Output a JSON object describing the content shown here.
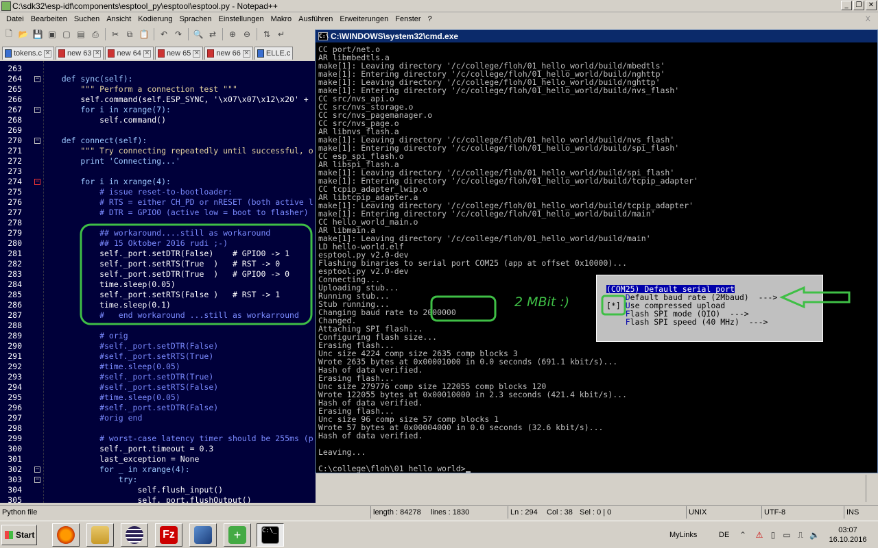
{
  "npp": {
    "title": "C:\\sdk32\\esp-idf\\components\\esptool_py\\esptool\\esptool.py - Notepad++",
    "menu": [
      "Datei",
      "Bearbeiten",
      "Suchen",
      "Ansicht",
      "Kodierung",
      "Sprachen",
      "Einstellungen",
      "Makro",
      "Ausführen",
      "Erweiterungen",
      "Fenster",
      "?"
    ],
    "menu_close": "X",
    "tabs": [
      "tokens.c",
      "new 63",
      "new 64",
      "new 65",
      "new 66",
      "ELLE.c"
    ],
    "status": {
      "type": "Python file",
      "length": "length : 84278",
      "lines": "lines : 1830",
      "ln": "Ln : 294",
      "col": "Col : 38",
      "sel": "Sel : 0 | 0",
      "eol": "UNIX",
      "enc": "UTF-8",
      "ins": "INS"
    }
  },
  "code_lines": [
    {
      "n": "263",
      "t": ""
    },
    {
      "n": "264",
      "t": "    def sync(self):"
    },
    {
      "n": "265",
      "t": "        \"\"\" Perform a connection test \"\"\""
    },
    {
      "n": "266",
      "t": "        self.command(self.ESP_SYNC, '\\x07\\x07\\x12\\x20' +"
    },
    {
      "n": "267",
      "t": "        for i in xrange(7):"
    },
    {
      "n": "268",
      "t": "            self.command()"
    },
    {
      "n": "269",
      "t": ""
    },
    {
      "n": "270",
      "t": "    def connect(self):"
    },
    {
      "n": "271",
      "t": "        \"\"\" Try connecting repeatedly until successful, o"
    },
    {
      "n": "272",
      "t": "        print 'Connecting...'"
    },
    {
      "n": "273",
      "t": ""
    },
    {
      "n": "274",
      "t": "        for i in xrange(4):"
    },
    {
      "n": "275",
      "t": "            # issue reset-to-bootloader:"
    },
    {
      "n": "276",
      "t": "            # RTS = either CH_PD or nRESET (both active l"
    },
    {
      "n": "277",
      "t": "            # DTR = GPIO0 (active low = boot to flasher)"
    },
    {
      "n": "278",
      "t": ""
    },
    {
      "n": "279",
      "t": "            ## workaround....still as workaround"
    },
    {
      "n": "280",
      "t": "            ## 15 Oktober 2016 rudi ;-)"
    },
    {
      "n": "281",
      "t": "            self._port.setDTR(False)    # GPIO0 -> 1"
    },
    {
      "n": "282",
      "t": "            self._port.setRTS(True  )   # RST -> 0"
    },
    {
      "n": "283",
      "t": "            self._port.setDTR(True  )   # GPIO0 -> 0"
    },
    {
      "n": "284",
      "t": "            time.sleep(0.05)"
    },
    {
      "n": "285",
      "t": "            self._port.setRTS(False )   # RST -> 1"
    },
    {
      "n": "286",
      "t": "            time.sleep(0.1)"
    },
    {
      "n": "287",
      "t": "            #   end workaround ...still as workarround"
    },
    {
      "n": "288",
      "t": ""
    },
    {
      "n": "289",
      "t": "            # orig"
    },
    {
      "n": "290",
      "t": "            #self._port.setDTR(False)"
    },
    {
      "n": "291",
      "t": "            #self._port.setRTS(True)"
    },
    {
      "n": "292",
      "t": "            #time.sleep(0.05)"
    },
    {
      "n": "293",
      "t": "            #self._port.setDTR(True)"
    },
    {
      "n": "294",
      "t": "            #self._port.setRTS(False)"
    },
    {
      "n": "295",
      "t": "            #time.sleep(0.05)"
    },
    {
      "n": "296",
      "t": "            #self._port.setDTR(False)"
    },
    {
      "n": "297",
      "t": "            #orig end"
    },
    {
      "n": "298",
      "t": ""
    },
    {
      "n": "299",
      "t": "            # worst-case latency timer should be 255ms (p"
    },
    {
      "n": "300",
      "t": "            self._port.timeout = 0.3"
    },
    {
      "n": "301",
      "t": "            last_exception = None"
    },
    {
      "n": "302",
      "t": "            for _ in xrange(4):"
    },
    {
      "n": "303",
      "t": "                try:"
    },
    {
      "n": "304",
      "t": "                    self.flush_input()"
    },
    {
      "n": "305",
      "t": "                    self._port.flushOutput()"
    }
  ],
  "cmd": {
    "title": "C:\\WINDOWS\\system32\\cmd.exe",
    "lines": [
      "CC port/net.o",
      "AR libmbedtls.a",
      "make[1]: Leaving directory '/c/college/floh/01_hello_world/build/mbedtls'",
      "make[1]: Entering directory '/c/college/floh/01_hello_world/build/nghttp'",
      "make[1]: Leaving directory '/c/college/floh/01_hello_world/build/nghttp'",
      "make[1]: Entering directory '/c/college/floh/01_hello_world/build/nvs_flash'",
      "CC src/nvs_api.o",
      "CC src/nvs_storage.o",
      "CC src/nvs_pagemanager.o",
      "CC src/nvs_page.o",
      "AR libnvs_flash.a",
      "make[1]: Leaving directory '/c/college/floh/01_hello_world/build/nvs_flash'",
      "make[1]: Entering directory '/c/college/floh/01_hello_world/build/spi_flash'",
      "CC esp_spi_flash.o",
      "AR libspi_flash.a",
      "make[1]: Leaving directory '/c/college/floh/01_hello_world/build/spi_flash'",
      "make[1]: Entering directory '/c/college/floh/01_hello_world/build/tcpip_adapter'",
      "CC tcpip_adapter_lwip.o",
      "AR libtcpip_adapter.a",
      "make[1]: Leaving directory '/c/college/floh/01_hello_world/build/tcpip_adapter'",
      "make[1]: Entering directory '/c/college/floh/01_hello_world/build/main'",
      "CC hello_world_main.o",
      "AR libmain.a",
      "make[1]: Leaving directory '/c/college/floh/01_hello_world/build/main'",
      "LD hello-world.elf",
      "esptool.py v2.0-dev",
      "Flashing binaries to serial port COM25 (app at offset 0x10000)...",
      "esptool.py v2.0-dev",
      "Connecting...",
      "Uploading stub...",
      "Running stub...",
      "Stub running...",
      "Changing baud rate to 2000000",
      "Changed.",
      "Attaching SPI flash...",
      "Configuring flash size...",
      "Erasing flash...",
      "Unc size 4224 comp size 2635 comp blocks 3",
      "Wrote 2635 bytes at 0x00001000 in 0.0 seconds (691.1 kbit/s)...",
      "Hash of data verified.",
      "Erasing flash...",
      "Unc size 279776 comp size 122055 comp blocks 120",
      "Wrote 122055 bytes at 0x00010000 in 2.3 seconds (421.4 kbit/s)...",
      "Hash of data verified.",
      "Erasing flash...",
      "Unc size 96 comp size 57 comp blocks 1",
      "Wrote 57 bytes at 0x00004000 in 0.0 seconds (32.6 kbit/s)...",
      "Hash of data verified.",
      "",
      "Leaving...",
      "",
      "C:\\college\\floh\\01_hello_world>"
    ]
  },
  "menuconfig": {
    "items": [
      {
        "prefix": "",
        "hot": "",
        "rest": "(COM25) Default serial port",
        "selected": true
      },
      {
        "prefix": "    ",
        "hot": "D",
        "rest": "efault baud rate (2Mbaud)  --->",
        "selected": false
      },
      {
        "prefix": "[*] ",
        "hot": "U",
        "rest": "se compressed upload",
        "selected": false
      },
      {
        "prefix": "    ",
        "hot": "F",
        "rest": "lash SPI mode (QIO)  --->",
        "selected": false
      },
      {
        "prefix": "    ",
        "hot": "F",
        "rest": "lash SPI speed (40 MHz)  --->",
        "selected": false
      }
    ]
  },
  "annotation": {
    "text": "2 MBit :)",
    "color": "#3fbf46"
  },
  "taskbar": {
    "start": "Start",
    "apps": [
      "firefox-icon",
      "file-explorer-icon",
      "eclipse-icon",
      "filezilla-icon",
      "virtualbox-icon",
      "tortoise-icon",
      "cmd-icon"
    ],
    "mylinks": "MyLinks",
    "lang": "DE",
    "time": "03:07",
    "date": "16.10.2016"
  }
}
